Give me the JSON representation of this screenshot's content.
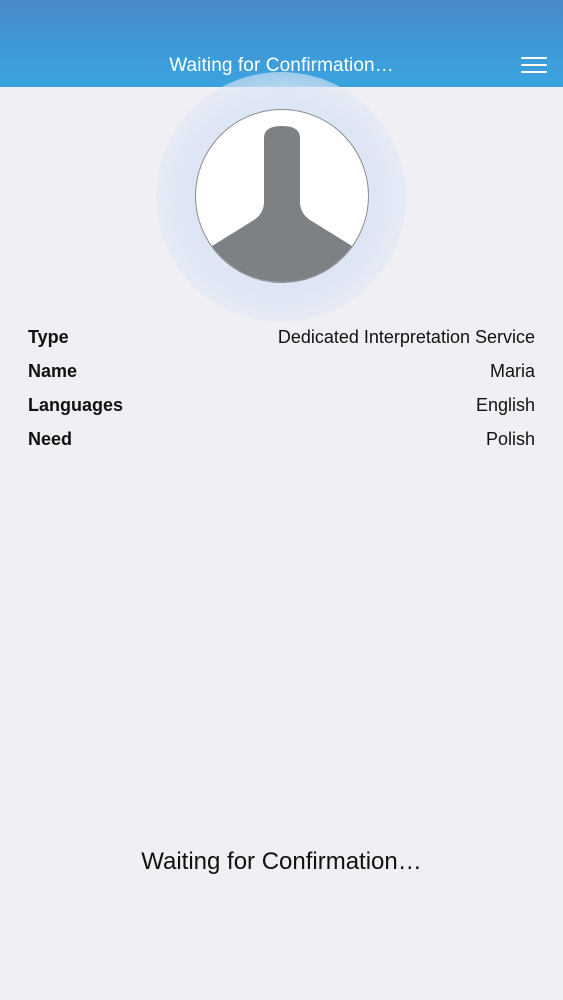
{
  "header": {
    "title": "Waiting for Confirmation…",
    "menu_icon": "hamburger-menu-icon"
  },
  "avatar": {
    "icon": "person-silhouette-icon"
  },
  "details": [
    {
      "label": "Type",
      "value": "Dedicated Interpretation Service"
    },
    {
      "label": "Name",
      "value": "Maria"
    },
    {
      "label": "Languages",
      "value": "English"
    },
    {
      "label": "Need",
      "value": "Polish"
    }
  ],
  "status": {
    "message": "Waiting for Confirmation…"
  },
  "colors": {
    "nav_bar": "#3d9bd8",
    "background": "#efeff4",
    "avatar_silhouette": "#7d8183"
  }
}
